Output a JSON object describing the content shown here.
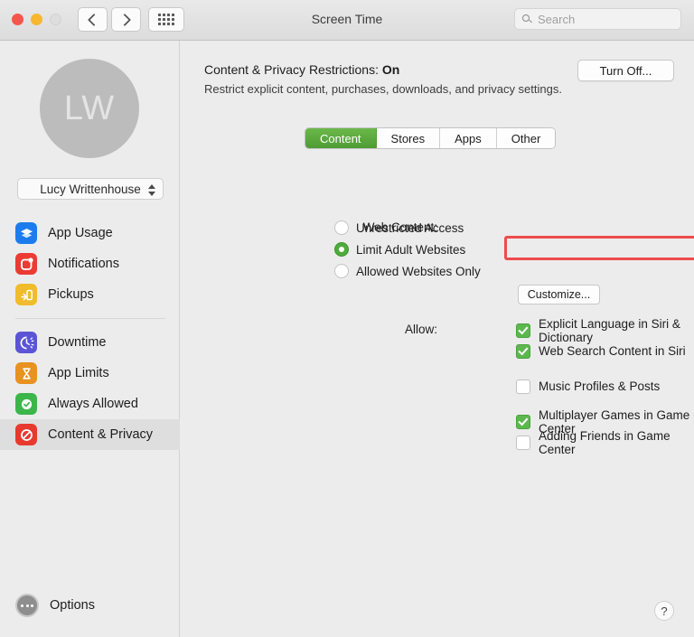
{
  "window": {
    "title": "Screen Time"
  },
  "titlebar": {
    "back_icon": "chevron-left-icon",
    "forward_icon": "chevron-right-icon",
    "grid_icon": "grid-icon",
    "search": {
      "placeholder": "Search",
      "value": "",
      "icon": "search-icon"
    }
  },
  "sidebar": {
    "avatar_initials": "LW",
    "user_name": "Lucy  Writtenhouse",
    "items": [
      {
        "label": "App Usage",
        "icon": "layers-icon",
        "color": "#1c7ced",
        "selected": false
      },
      {
        "label": "Notifications",
        "icon": "notification-icon",
        "color": "#ec3b33",
        "selected": false
      },
      {
        "label": "Pickups",
        "icon": "pickup-icon",
        "color": "#f0bc2c",
        "selected": false
      },
      {
        "label": "Downtime",
        "icon": "downtime-icon",
        "color": "#5b55d6",
        "selected": false
      },
      {
        "label": "App Limits",
        "icon": "hourglass-icon",
        "color": "#e8921f",
        "selected": false
      },
      {
        "label": "Always Allowed",
        "icon": "check-badge-icon",
        "color": "#3cb54a",
        "selected": false
      },
      {
        "label": "Content & Privacy",
        "icon": "prohibition-icon",
        "color": "#e8392f",
        "selected": true
      }
    ],
    "divider_after_index": 2,
    "options_label": "Options",
    "options_icon": "ellipsis-circle-icon"
  },
  "main": {
    "restriction_status_prefix": "Content & Privacy Restrictions: ",
    "restriction_status_value": "On",
    "restriction_subtitle": "Restrict explicit content, purchases, downloads, and privacy settings.",
    "turn_off_label": "Turn Off...",
    "tabs": [
      {
        "label": "Content",
        "active": true
      },
      {
        "label": "Stores",
        "active": false
      },
      {
        "label": "Apps",
        "active": false
      },
      {
        "label": "Other",
        "active": false
      }
    ],
    "web_content": {
      "label": "Web Content:",
      "options": [
        {
          "label": "Unrestricted Access",
          "selected": false,
          "highlighted": false
        },
        {
          "label": "Limit Adult Websites",
          "selected": true,
          "highlighted": true
        },
        {
          "label": "Allowed Websites Only",
          "selected": false,
          "highlighted": false
        }
      ],
      "customize_label": "Customize..."
    },
    "allow": {
      "label": "Allow:",
      "group1": [
        {
          "label": "Explicit Language in Siri & Dictionary",
          "checked": true
        },
        {
          "label": "Web Search Content in Siri",
          "checked": true
        }
      ],
      "group2": [
        {
          "label": "Music Profiles & Posts",
          "checked": false
        }
      ],
      "group3": [
        {
          "label": "Multiplayer Games in Game Center",
          "checked": true
        },
        {
          "label": "Adding Friends in Game Center",
          "checked": false
        }
      ]
    },
    "help_label": "?"
  },
  "colors": {
    "accent_green": "#4e9c34",
    "highlight_red": "#ef4b4b",
    "selected_row": "#dedede"
  }
}
